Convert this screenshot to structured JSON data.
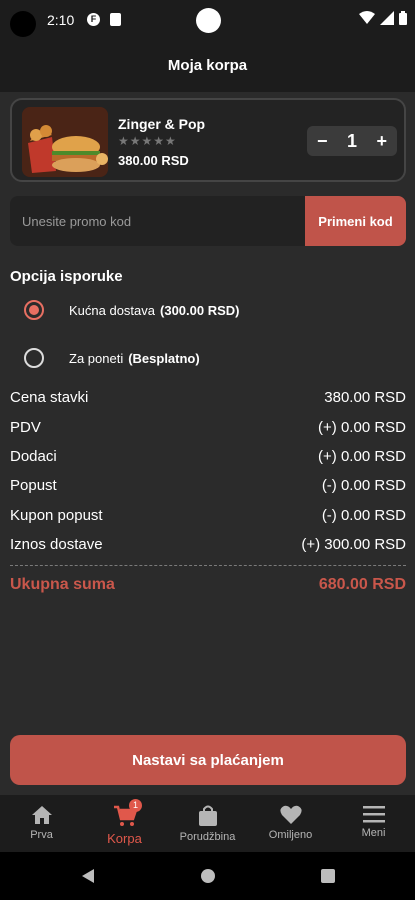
{
  "status_bar": {
    "time": "2:10"
  },
  "header": {
    "title": "Moja korpa"
  },
  "cart": {
    "item": {
      "name": "Zinger & Pop",
      "stars": "★★★★★",
      "price": "380.00 RSD",
      "quantity": "1",
      "decrement": "−",
      "increment": "+"
    }
  },
  "promo": {
    "placeholder": "Unesite promo kod",
    "button": "Primeni kod"
  },
  "delivery": {
    "title": "Opcija isporuke",
    "options": [
      {
        "label": "Kućna dostava",
        "extra": "(300.00 RSD)",
        "selected": true
      },
      {
        "label": "Za poneti",
        "extra": "(Besplatno)",
        "selected": false
      }
    ]
  },
  "summary": {
    "rows": [
      {
        "label": "Cena stavki",
        "value": "380.00 RSD"
      },
      {
        "label": "PDV",
        "value": "(+) 0.00 RSD"
      },
      {
        "label": "Dodaci",
        "value": "(+) 0.00 RSD"
      },
      {
        "label": "Popust",
        "value": "(-) 0.00 RSD"
      },
      {
        "label": "Kupon popust",
        "value": "(-) 0.00 RSD"
      },
      {
        "label": "Iznos dostave",
        "value": "(+) 300.00 RSD"
      }
    ],
    "total_label": "Ukupna suma",
    "total_value": "680.00 RSD"
  },
  "cta": {
    "label": "Nastavi sa plaćanjem"
  },
  "bottom_nav": {
    "items": [
      {
        "label": "Prva",
        "icon": "home-icon"
      },
      {
        "label": "Korpa",
        "icon": "cart-icon",
        "badge": "1",
        "active": true
      },
      {
        "label": "Porudžbina",
        "icon": "bag-icon"
      },
      {
        "label": "Omiljeno",
        "icon": "heart-icon"
      },
      {
        "label": "Meni",
        "icon": "menu-icon"
      }
    ]
  },
  "colors": {
    "accent": "#c0544a",
    "total": "#c9574b",
    "background": "#2b2b2b",
    "bar": "#1c1c1c"
  }
}
